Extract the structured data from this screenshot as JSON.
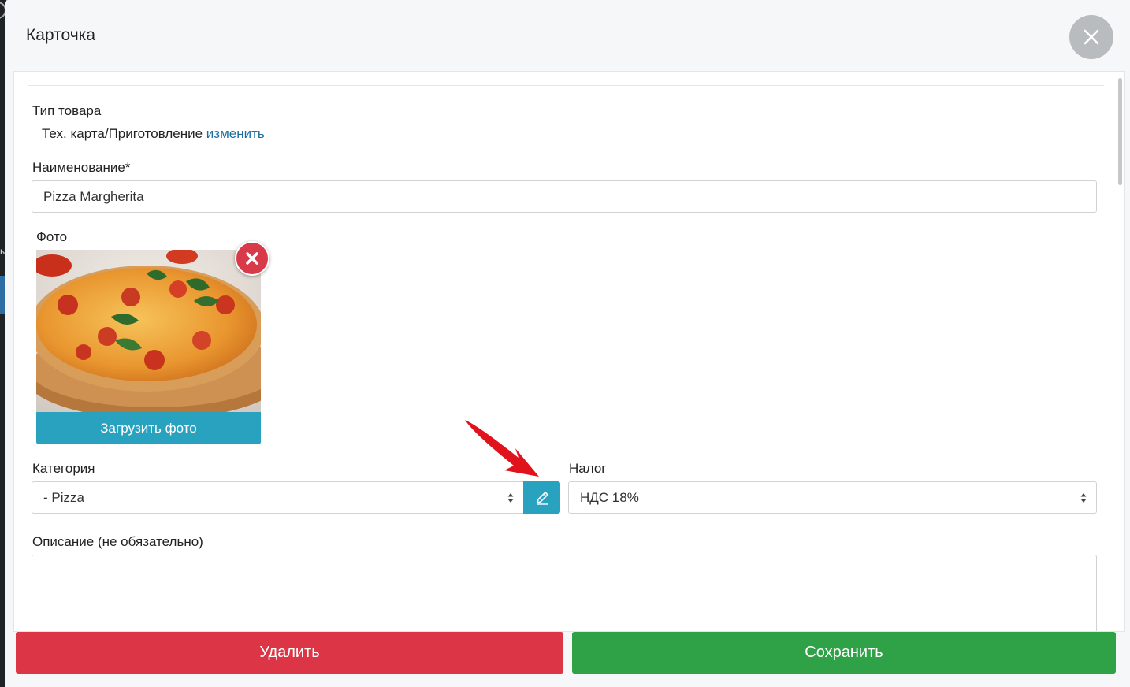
{
  "modal": {
    "title": "Карточка"
  },
  "form": {
    "product_type": {
      "label": "Тип товара",
      "value": "Тех. карта/Приготовление",
      "change_link": "изменить"
    },
    "name": {
      "label": "Наименование*",
      "value": "Pizza Margherita"
    },
    "photo": {
      "label": "Фото",
      "upload_label": "Загрузить фото"
    },
    "category": {
      "label": "Категория",
      "selected": "- Pizza"
    },
    "tax": {
      "label": "Налог",
      "selected": "НДС 18%"
    },
    "description": {
      "label": "Описание (не обязательно)",
      "value": ""
    }
  },
  "actions": {
    "delete_label": "Удалить",
    "save_label": "Сохранить"
  },
  "colors": {
    "accent": "#29a2c0",
    "link": "#1f6f9e",
    "danger": "#dc3545",
    "success": "#2fa147",
    "annotation_arrow": "#e0121b"
  },
  "icons": {
    "close": "close-icon",
    "remove_photo": "remove-x-icon",
    "edit_category": "pencil-icon",
    "select": "chevron-updown-icon"
  }
}
